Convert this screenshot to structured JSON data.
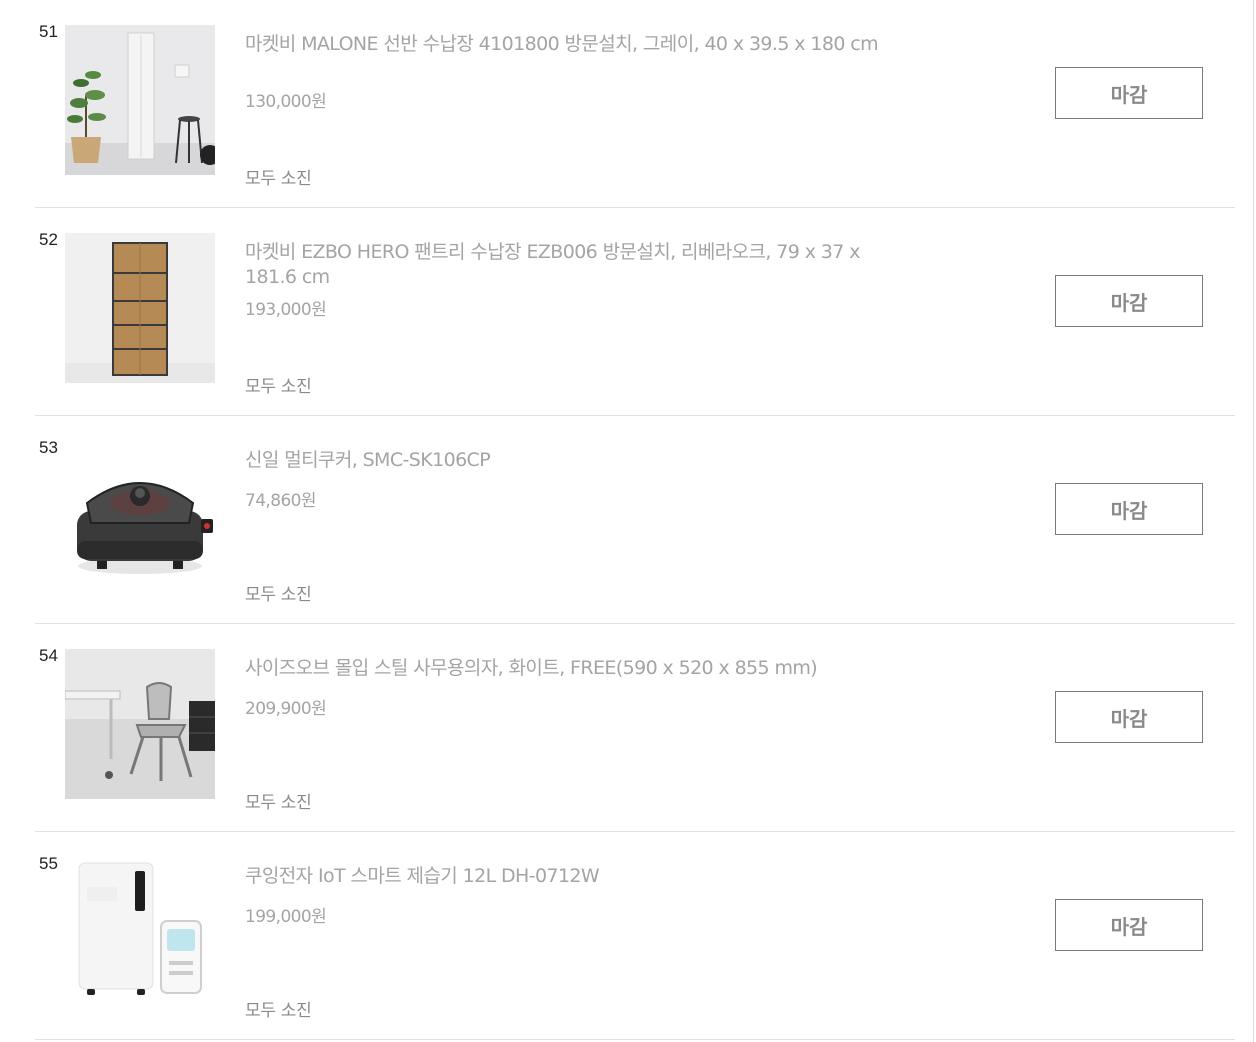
{
  "items": [
    {
      "num": "51",
      "title": "마켓비 MALONE 선반 수납장 4101800 방문설치, 그레이, 40 x 39.5 x 180 cm",
      "price": "130,000원",
      "status": "모두 소진",
      "button": "마감"
    },
    {
      "num": "52",
      "title": "마켓비 EZBO HERO 팬트리 수납장 EZB006 방문설치, 리베라오크, 79 x 37 x 181.6 cm",
      "price": "193,000원",
      "status": "모두 소진",
      "button": "마감"
    },
    {
      "num": "53",
      "title": "신일 멀티쿠커, SMC-SK106CP",
      "price": "74,860원",
      "status": "모두 소진",
      "button": "마감"
    },
    {
      "num": "54",
      "title": "사이즈오브 몰입 스틸 사무용의자, 화이트, FREE(590 x 520 x 855 mm)",
      "price": "209,900원",
      "status": "모두 소진",
      "button": "마감"
    },
    {
      "num": "55",
      "title": "쿠잉전자 IoT 스마트 제습기 12L DH-0712W",
      "price": "199,000원",
      "status": "모두 소진",
      "button": "마감"
    }
  ]
}
